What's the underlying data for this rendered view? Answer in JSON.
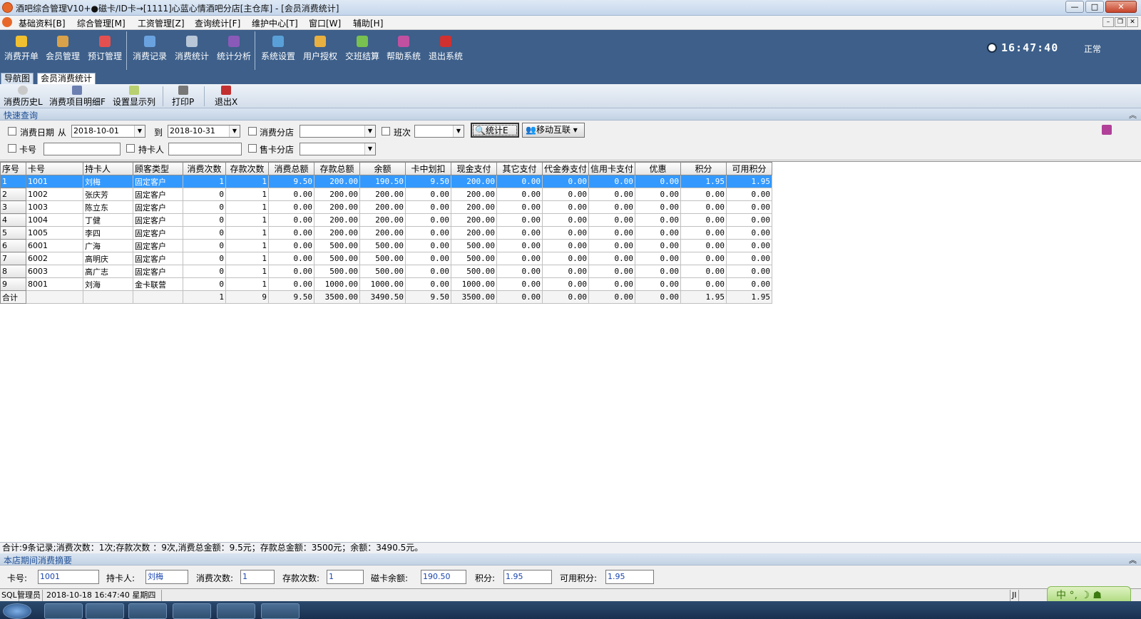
{
  "window": {
    "title": "酒吧综合管理V10+●磁卡/ID卡→[1111]心蓝心情酒吧分店[主仓库] - [会员消费统计]",
    "buttons": [
      "—",
      "□",
      "✕"
    ]
  },
  "menu": [
    "基础资料[B]",
    "综合管理[M]",
    "工资管理[Z]",
    "查询统计[F]",
    "维护中心[T]",
    "窗口[W]",
    "辅助[H]"
  ],
  "toolbar": {
    "items": [
      "消费开单",
      "会员管理",
      "预订管理",
      "消费记录",
      "消费统计",
      "统计分析",
      "系统设置",
      "用户授权",
      "交班结算",
      "帮助系统",
      "退出系统"
    ],
    "clock": "16:47:40",
    "status": "正常"
  },
  "tabs": [
    "导航图",
    "会员消费统计"
  ],
  "subtoolbar": [
    "消费历史L",
    "消费项目明细F",
    "设置显示列",
    "打印P",
    "退出X"
  ],
  "query": {
    "header": "快速查询",
    "date_label": "消费日期",
    "from_label": "从",
    "date_from": "2018-10-01",
    "to_label": "到",
    "date_to": "2018-10-31",
    "branch_label": "消费分店",
    "shift_label": "班次",
    "stat_button": "统计E",
    "mobile_button": "移动互联",
    "card_label": "卡号",
    "holder_label": "持卡人",
    "sell_branch_label": "售卡分店"
  },
  "table": {
    "columns": [
      "序号",
      "卡号",
      "持卡人",
      "顾客类型",
      "消费次数",
      "存款次数",
      "消费总额",
      "存款总额",
      "余额",
      "卡中划扣",
      "现金支付",
      "其它支付",
      "代金券支付",
      "信用卡支付",
      "优惠",
      "积分",
      "可用积分"
    ],
    "rows": [
      [
        "1",
        "1001",
        "刘梅",
        "固定客户",
        "1",
        "1",
        "9.50",
        "200.00",
        "190.50",
        "9.50",
        "200.00",
        "0.00",
        "0.00",
        "0.00",
        "0.00",
        "1.95",
        "1.95"
      ],
      [
        "2",
        "1002",
        "张庆芳",
        "固定客户",
        "0",
        "1",
        "0.00",
        "200.00",
        "200.00",
        "0.00",
        "200.00",
        "0.00",
        "0.00",
        "0.00",
        "0.00",
        "0.00",
        "0.00"
      ],
      [
        "3",
        "1003",
        "陈立东",
        "固定客户",
        "0",
        "1",
        "0.00",
        "200.00",
        "200.00",
        "0.00",
        "200.00",
        "0.00",
        "0.00",
        "0.00",
        "0.00",
        "0.00",
        "0.00"
      ],
      [
        "4",
        "1004",
        "丁健",
        "固定客户",
        "0",
        "1",
        "0.00",
        "200.00",
        "200.00",
        "0.00",
        "200.00",
        "0.00",
        "0.00",
        "0.00",
        "0.00",
        "0.00",
        "0.00"
      ],
      [
        "5",
        "1005",
        "李四",
        "固定客户",
        "0",
        "1",
        "0.00",
        "200.00",
        "200.00",
        "0.00",
        "200.00",
        "0.00",
        "0.00",
        "0.00",
        "0.00",
        "0.00",
        "0.00"
      ],
      [
        "6",
        "6001",
        "广海",
        "固定客户",
        "0",
        "1",
        "0.00",
        "500.00",
        "500.00",
        "0.00",
        "500.00",
        "0.00",
        "0.00",
        "0.00",
        "0.00",
        "0.00",
        "0.00"
      ],
      [
        "7",
        "6002",
        "高明庆",
        "固定客户",
        "0",
        "1",
        "0.00",
        "500.00",
        "500.00",
        "0.00",
        "500.00",
        "0.00",
        "0.00",
        "0.00",
        "0.00",
        "0.00",
        "0.00"
      ],
      [
        "8",
        "6003",
        "高广志",
        "固定客户",
        "0",
        "1",
        "0.00",
        "500.00",
        "500.00",
        "0.00",
        "500.00",
        "0.00",
        "0.00",
        "0.00",
        "0.00",
        "0.00",
        "0.00"
      ],
      [
        "9",
        "8001",
        "刘海",
        "金卡联营",
        "0",
        "1",
        "0.00",
        "1000.00",
        "1000.00",
        "0.00",
        "1000.00",
        "0.00",
        "0.00",
        "0.00",
        "0.00",
        "0.00",
        "0.00"
      ]
    ],
    "total": [
      "合计",
      "",
      "",
      "",
      "1",
      "9",
      "9.50",
      "3500.00",
      "3490.50",
      "9.50",
      "3500.00",
      "0.00",
      "0.00",
      "0.00",
      "0.00",
      "1.95",
      "1.95"
    ]
  },
  "summary": "合计:9条记录;消费次数：1次;存款次数 ：9次,消费总金额：9.5元；存款总金额：3500元；余额：3490.5元。",
  "bottom": {
    "header": "本店期间消费摘要",
    "card_label": "卡号:",
    "card": "1001",
    "holder_label": "持卡人:",
    "holder": "刘梅",
    "consume_label": "消费次数:",
    "consume": "1",
    "deposit_label": "存款次数:",
    "deposit": "1",
    "balance_label": "磁卡余额:",
    "balance": "190.50",
    "points_label": "积分:",
    "points": "1.95",
    "avail_label": "可用积分:",
    "avail": "1.95"
  },
  "statusbar": [
    "SQL",
    "管理员",
    "2018-10-18 16:47:40 星期四",
    "JI"
  ],
  "ime": "中 °, ☽ ☗",
  "colors": {
    "toolbar": "#3d5f8a",
    "selected_row": "#3399ff",
    "accent_text": "#1f4f95"
  }
}
